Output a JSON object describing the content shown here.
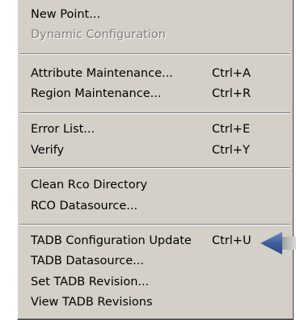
{
  "menu": {
    "groups": [
      {
        "items": [
          {
            "label": "New Point...",
            "shortcut": "",
            "enabled": true
          },
          {
            "label": "Dynamic Configuration",
            "shortcut": "",
            "enabled": false
          }
        ]
      },
      {
        "items": [
          {
            "label": "Attribute Maintenance...",
            "shortcut": "Ctrl+A",
            "enabled": true
          },
          {
            "label": "Region Maintenance...",
            "shortcut": "Ctrl+R",
            "enabled": true
          }
        ]
      },
      {
        "items": [
          {
            "label": "Error List...",
            "shortcut": "Ctrl+E",
            "enabled": true
          },
          {
            "label": "Verify",
            "shortcut": "Ctrl+Y",
            "enabled": true
          }
        ]
      },
      {
        "items": [
          {
            "label": "Clean Rco Directory",
            "shortcut": "",
            "enabled": true
          },
          {
            "label": "RCO Datasource...",
            "shortcut": "",
            "enabled": true
          }
        ]
      },
      {
        "items": [
          {
            "label": "TADB Configuration Update",
            "shortcut": "Ctrl+U",
            "enabled": true
          },
          {
            "label": "TADB Datasource...",
            "shortcut": "",
            "enabled": true
          },
          {
            "label": "Set TADB Revision...",
            "shortcut": "",
            "enabled": true
          },
          {
            "label": "View TADB Revisions",
            "shortcut": "",
            "enabled": true
          }
        ]
      }
    ]
  },
  "pointer": {
    "icon": "left-arrow-icon",
    "color": "#4a6aa3"
  },
  "colors": {
    "menu_background": "#d4d0c8",
    "disabled_text": "#808080"
  }
}
